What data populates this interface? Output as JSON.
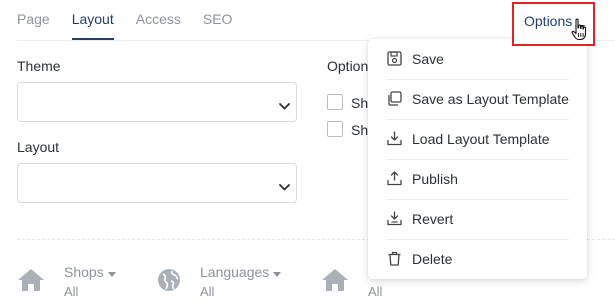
{
  "tabs": [
    {
      "label": "Page"
    },
    {
      "label": "Layout"
    },
    {
      "label": "Access"
    },
    {
      "label": "SEO"
    }
  ],
  "active_tab": "Layout",
  "options": {
    "label": "Options"
  },
  "form": {
    "theme_label": "Theme",
    "theme_value": "",
    "layout_label": "Layout",
    "layout_value": "",
    "options_label": "Option",
    "checkboxes": [
      {
        "label": "Sh",
        "checked": false
      },
      {
        "label": "Sh",
        "checked": false
      }
    ]
  },
  "bottom": {
    "shops": {
      "title": "Shops",
      "sub": "All",
      "icon": "home-icon"
    },
    "languages": {
      "title": "Languages",
      "sub": "All",
      "icon": "globe-icon"
    },
    "third": {
      "title": "",
      "sub": "All",
      "icon": "home-icon"
    }
  },
  "menu": {
    "items": [
      {
        "label": "Save",
        "icon": "save-icon"
      },
      {
        "label": "Save as Layout Template",
        "icon": "copy-icon"
      },
      {
        "label": "Load Layout Template",
        "icon": "download-icon"
      },
      {
        "label": "Publish",
        "icon": "upload-icon"
      },
      {
        "label": "Revert",
        "icon": "revert-icon"
      },
      {
        "label": "Delete",
        "icon": "trash-icon"
      }
    ]
  },
  "colors": {
    "accent": "#1f3f6e",
    "highlight_border": "#e02424",
    "muted_text": "#8c939b"
  }
}
